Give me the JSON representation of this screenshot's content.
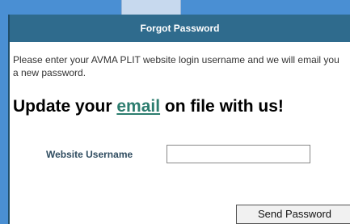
{
  "panel": {
    "title": "Forgot Password",
    "instructions": "Please enter your AVMA PLIT website login username and we will email you a new password.",
    "headline_prefix": "Update your ",
    "headline_link": "email",
    "headline_suffix": " on file with us!"
  },
  "form": {
    "username_label": "Website Username",
    "username_value": "",
    "submit_label": "Send Password"
  },
  "colors": {
    "header_bg": "#2f6b8d",
    "page_bg": "#4a8fd3",
    "link": "#2d7d6f"
  }
}
